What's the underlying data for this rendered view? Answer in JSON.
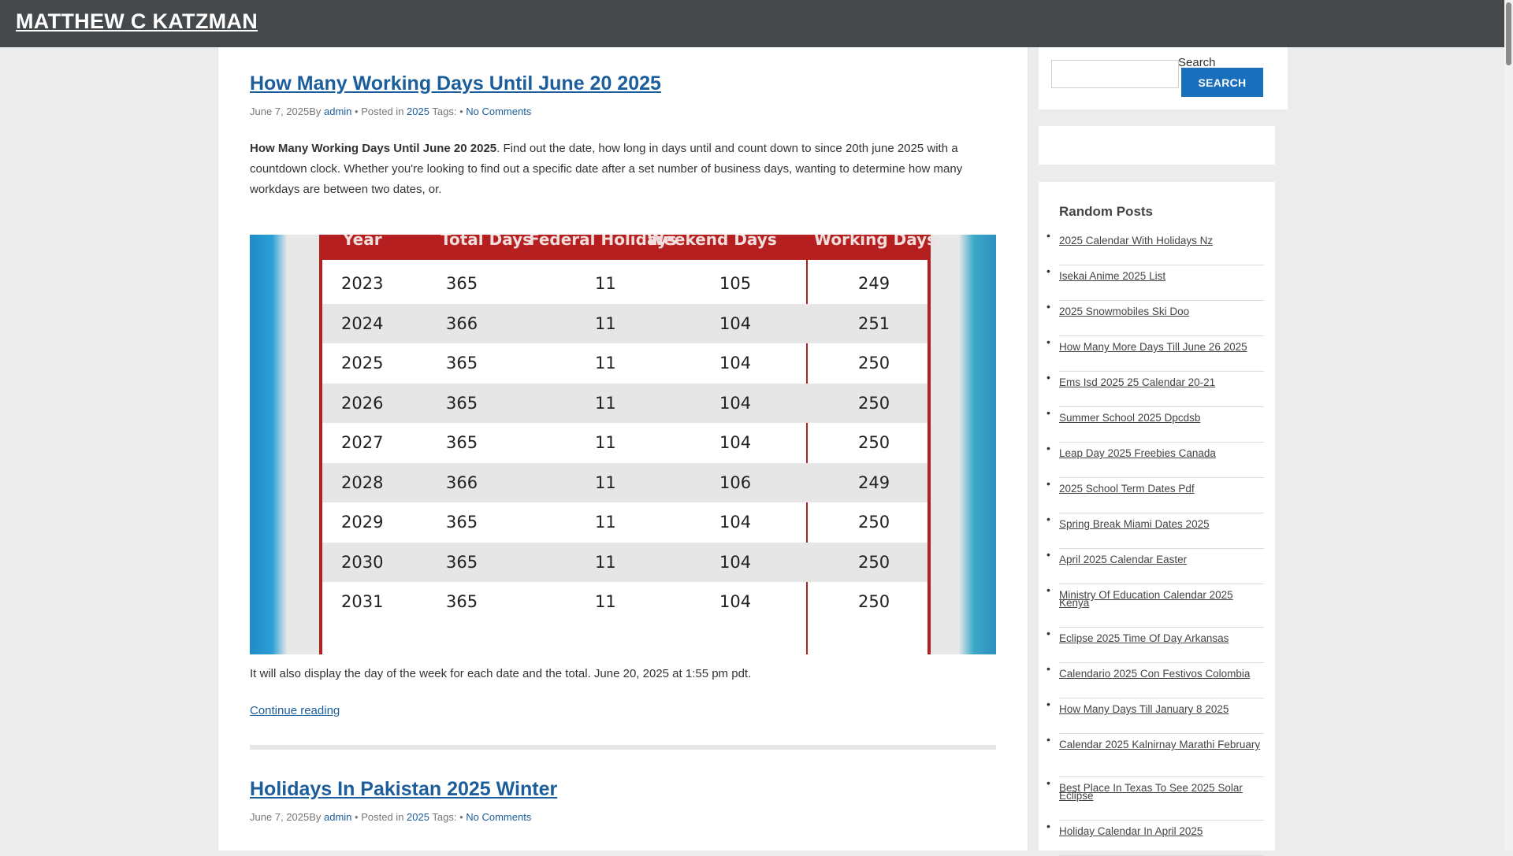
{
  "site": {
    "title": "MATTHEW C KATZMAN"
  },
  "posts": [
    {
      "title": "How Many Working Days Until June 20 2025",
      "date": "June 7, 2025",
      "by": "By",
      "author": "admin",
      "posted_in_label": "Posted in",
      "category": "2025",
      "tags_label": "Tags:",
      "comments": "No Comments",
      "excerpt_bold": "How Many Working Days Until June 20 2025",
      "excerpt_rest": ". Find out the date, how long in days until and count down to since 20th june 2025 with a countdown clock. Whether you're looking to find out a specific date after a set number of business days, wanting to determine how many workdays are between two dates, or.",
      "image_table": {
        "headers": [
          "Year",
          "Total Days",
          "Federal Holidays",
          "Weekend Days",
          "Working Days"
        ],
        "rows": [
          [
            "2023",
            "365",
            "11",
            "105",
            "249"
          ],
          [
            "2024",
            "366",
            "11",
            "104",
            "251"
          ],
          [
            "2025",
            "365",
            "11",
            "104",
            "250"
          ],
          [
            "2026",
            "365",
            "11",
            "104",
            "250"
          ],
          [
            "2027",
            "365",
            "11",
            "104",
            "250"
          ],
          [
            "2028",
            "366",
            "11",
            "106",
            "249"
          ],
          [
            "2029",
            "365",
            "11",
            "104",
            "250"
          ],
          [
            "2030",
            "365",
            "11",
            "104",
            "250"
          ],
          [
            "2031",
            "365",
            "11",
            "104",
            "250"
          ]
        ]
      },
      "after_text": "It will also display the day of the week for each date and the total. June 20, 2025 at 1:55 pm pdt.",
      "continue": "Continue reading"
    },
    {
      "title": "Holidays In Pakistan 2025 Winter",
      "date": "June 7, 2025",
      "by": "By",
      "author": "admin",
      "posted_in_label": "Posted in",
      "category": "2025",
      "tags_label": "Tags:",
      "comments": "No Comments"
    }
  ],
  "sidebar": {
    "search_label": "Search",
    "search_value": "",
    "search_button": "SEARCH",
    "random_posts_title": "Random Posts",
    "random_posts": [
      "2025 Calendar With Holidays Nz",
      "Isekai Anime 2025 List",
      "2025 Snowmobiles Ski Doo",
      "How Many More Days Till June 26 2025",
      "Ems Isd 2025 25 Calendar 20-21",
      "Summer School 2025 Dpcdsb",
      "Leap Day 2025 Freebies Canada",
      "2025 School Term Dates Pdf",
      "Spring Break Miami Dates 2025",
      "April 2025 Calendar Easter",
      "Ministry Of Education Calendar 2025 Kenya",
      "Eclipse 2025 Time Of Day Arkansas",
      "Calendario 2025 Con Festivos Colombia",
      "How Many Days Till January 8 2025",
      "Calendar 2025 Kalnirnay Marathi February",
      "Best Place In Texas To See 2025 Solar Eclipse",
      "Holiday Calendar In April 2025"
    ]
  },
  "colors": {
    "header_bg": "#45494c",
    "link": "#1b5e9b",
    "button": "#1a6fbd",
    "table_accent": "#b51f1f"
  }
}
